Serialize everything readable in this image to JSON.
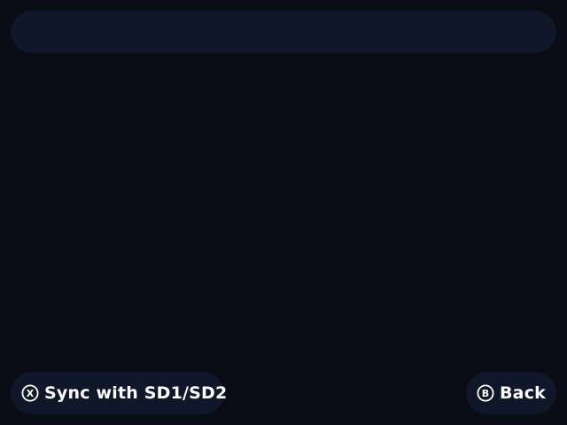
{
  "top_bar": {
    "title": ""
  },
  "footer": {
    "primary_action": {
      "button_glyph": "X",
      "label": "Sync with SD1/SD2",
      "icon": "x-button-icon"
    },
    "secondary_action": {
      "button_glyph": "B",
      "label": "Back",
      "icon": "b-button-icon"
    }
  },
  "colors": {
    "background": "#090c14",
    "panel": "#10172a",
    "text": "#ffffff"
  }
}
